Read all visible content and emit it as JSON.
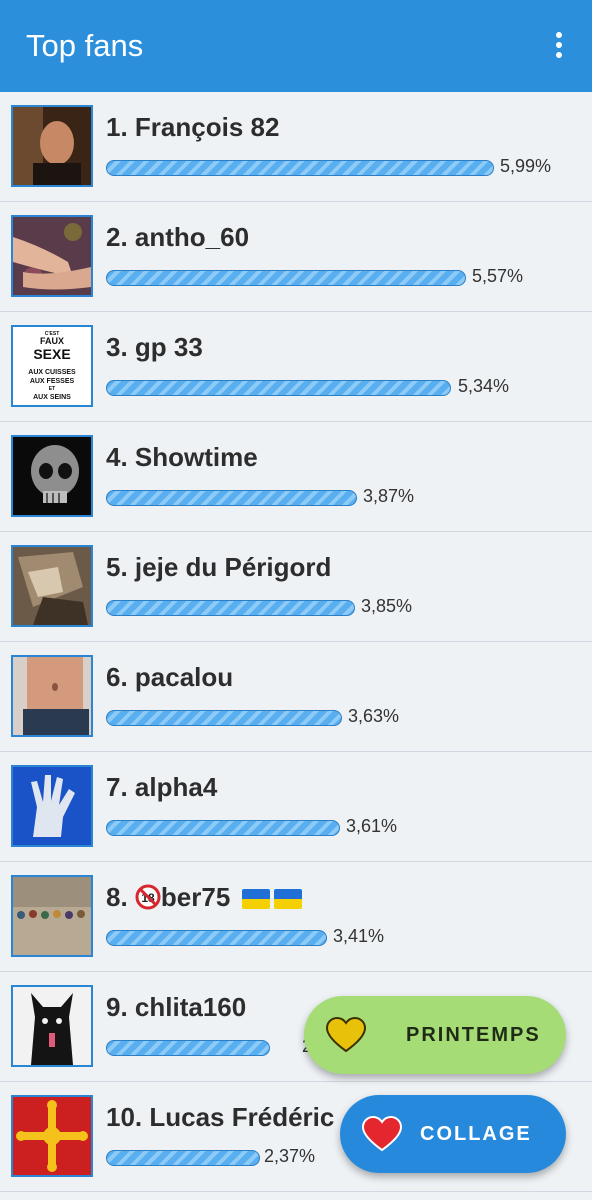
{
  "header": {
    "title": "Top fans"
  },
  "fans": [
    {
      "name": "1. François 82",
      "percent": "5,99%",
      "share": 5.99,
      "avatar": "person-photo"
    },
    {
      "name": "2. antho_60",
      "percent": "5,57%",
      "share": 5.57,
      "avatar": "feet-photo"
    },
    {
      "name": "3. gp 33",
      "percent": "5,34%",
      "share": 5.34,
      "avatar": "text-poster",
      "avatar_text": [
        "C'EST",
        "FAUX",
        "SEXE",
        "AUX CUISSES",
        "AUX FESSES",
        "ET",
        "AUX SEINS"
      ]
    },
    {
      "name": "4. Showtime",
      "percent": "3,87%",
      "share": 3.87,
      "avatar": "skull-photo"
    },
    {
      "name": "5. jeje du Périgord",
      "percent": "3,85%",
      "share": 3.85,
      "avatar": "stone-photo"
    },
    {
      "name": "6. pacalou",
      "percent": "3,63%",
      "share": 3.63,
      "avatar": "torso-photo"
    },
    {
      "name": "7. alpha4",
      "percent": "3,61%",
      "share": 3.61,
      "avatar": "glove-photo"
    },
    {
      "name": "8. ",
      "name_rest": "ber75",
      "percent": "3,41%",
      "share": 3.41,
      "avatar": "beads-photo",
      "prefix_icon": "no-18-icon",
      "suffix_icons": [
        "ukraine-flag-icon",
        "ukraine-flag-icon"
      ]
    },
    {
      "name": "9. chlita160",
      "percent": "2",
      "share": 2.37,
      "avatar": "cat-drawing"
    },
    {
      "name": "10. Lucas Frédéric",
      "percent": "2,37%",
      "share": 2.37,
      "avatar": "occitan-cross"
    }
  ],
  "fabs": {
    "printemps": {
      "label": "PRINTEMPS",
      "icon": "heart-icon",
      "color": "#a6dc75"
    },
    "collage": {
      "label": "COLLAGE",
      "icon": "heart-icon",
      "color": "#2789dc"
    }
  },
  "colors": {
    "appbar": "#2b8fdc",
    "bar": "#59aef0",
    "background": "#eef2f5"
  }
}
